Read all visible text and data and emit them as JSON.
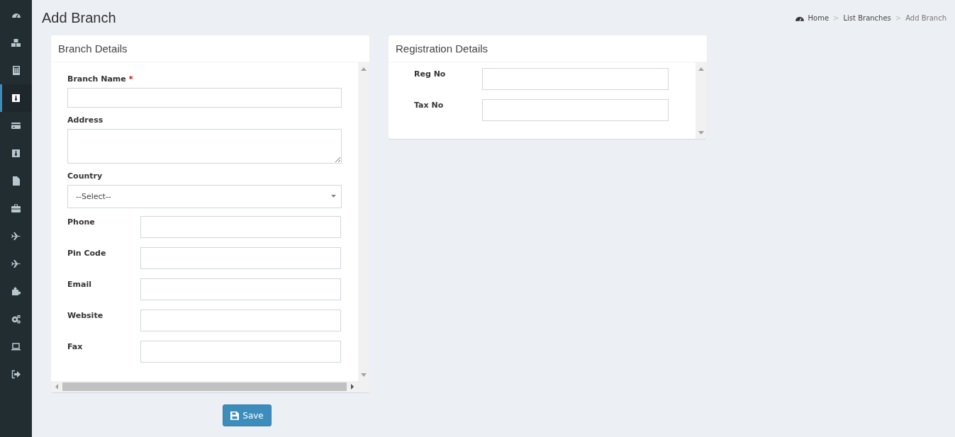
{
  "sidebar": {
    "items": [
      {
        "selected": false
      },
      {
        "selected": false
      },
      {
        "selected": false
      },
      {
        "selected": true
      },
      {
        "selected": false
      },
      {
        "selected": false
      },
      {
        "selected": false
      },
      {
        "selected": false
      },
      {
        "selected": false
      },
      {
        "selected": false
      },
      {
        "selected": false
      },
      {
        "selected": false
      },
      {
        "selected": false
      },
      {
        "selected": false
      }
    ]
  },
  "page_title": "Add Branch",
  "breadcrumb": [
    {
      "label": "Home",
      "current": false
    },
    {
      "separator": ">",
      "label": "List Branches",
      "current": false
    },
    {
      "separator": ">",
      "label": "Add Branch",
      "current": true
    }
  ],
  "panels": [
    {
      "title": "Branch Details",
      "horizontal_scroll": true,
      "fields": [
        {
          "label": "Branch Name",
          "required_mark": "*",
          "kind": "text"
        },
        {
          "label": "Address",
          "kind": "textarea"
        },
        {
          "label": "Country",
          "kind": "select",
          "value": "--Select--"
        },
        {
          "label": "Phone",
          "kind": "inline"
        },
        {
          "label": "Pin Code",
          "kind": "inline"
        },
        {
          "label": "Email",
          "kind": "inline"
        },
        {
          "label": "Website",
          "kind": "inline"
        },
        {
          "label": "Fax",
          "kind": "inline"
        }
      ]
    },
    {
      "title": "Registration Details",
      "horizontal_scroll": false,
      "fields": [
        {
          "label": "Reg No",
          "kind": "wide"
        },
        {
          "label": "Tax No",
          "kind": "wide"
        }
      ]
    }
  ],
  "save_button": "Save"
}
